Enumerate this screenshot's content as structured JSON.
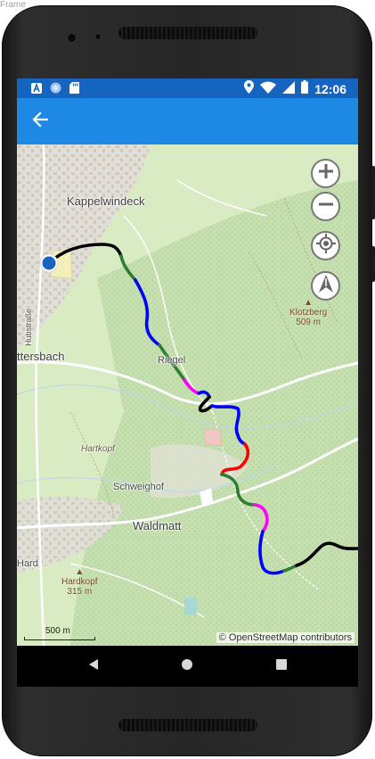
{
  "frame_label": "Frame",
  "status_bar": {
    "time": "12:06",
    "left_icons": [
      "a-badge-icon",
      "circle-icon",
      "sd-card-icon"
    ],
    "right_icons": [
      "location-icon",
      "wifi-icon",
      "signal-icon",
      "battery-icon"
    ],
    "bar_color": "#1565c0"
  },
  "app_bar": {
    "back_icon": "arrow-back-icon",
    "color": "#1e88e5"
  },
  "map": {
    "labels": {
      "kappelwindeck": "Kappelwindeck",
      "ottersbach": "ttersbach",
      "riegel": "Riegel",
      "hubstrasse": "Hubstraße",
      "hartkopf_wood": "Hartkopf",
      "schweighof": "Schweighof",
      "waldmatt": "Waldmatt",
      "hard": "Hard"
    },
    "peaks": {
      "klotzberg_name": "Klotzberg",
      "klotzberg_elev": "509 m",
      "hardkopf_name": "Hardkopf",
      "hardkopf_elev": "315 m"
    },
    "scale": "500 m",
    "attribution": "© OpenStreetMap contributors",
    "track_colors": [
      "#000000",
      "#2e7d32",
      "#0000ff",
      "#ff00ff",
      "#ff0000"
    ]
  },
  "controls": [
    "zoom-in-icon",
    "zoom-out-icon",
    "my-location-icon",
    "compass-icon"
  ],
  "navigation": [
    "nav-back-icon",
    "nav-home-icon",
    "nav-recents-icon"
  ]
}
